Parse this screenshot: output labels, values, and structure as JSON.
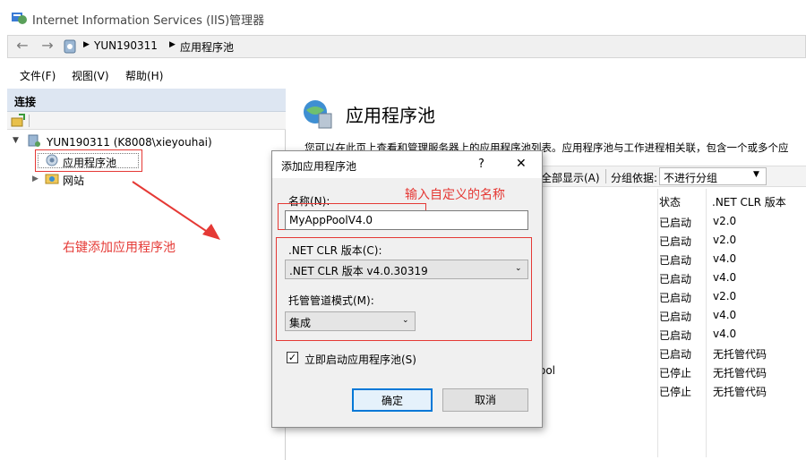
{
  "window": {
    "title": "Internet Information Services (IIS)管理器"
  },
  "address": {
    "crumbs": [
      "YUN190311",
      "应用程序池"
    ]
  },
  "menu": {
    "file": "文件(F)",
    "view": "视图(V)",
    "help": "帮助(H)"
  },
  "connections": {
    "header": "连接",
    "server_node": "YUN190311 (K8008\\xieyouhai)",
    "app_pools_node": "应用程序池",
    "sites_node": "网站"
  },
  "main": {
    "title": "应用程序池",
    "description": "您可以在此页上查看和管理服务器上的应用程序池列表。应用程序池与工作进程相关联，包含一个或多个应",
    "show_all": "全部显示(A)",
    "group_by_label": "分组依据:",
    "group_by_value": "不进行分组",
    "columns": {
      "status": "状态",
      "clr": ".NET CLR 版本"
    },
    "rows": [
      {
        "status": "已启动",
        "clr": "v2.0"
      },
      {
        "status": "已启动",
        "clr": "v2.0"
      },
      {
        "status": "已启动",
        "clr": "v4.0"
      },
      {
        "status": "已启动",
        "clr": "v4.0"
      },
      {
        "status": "已启动",
        "clr": "v2.0"
      },
      {
        "status": "已启动",
        "clr": "v4.0"
      },
      {
        "status": "已启动",
        "clr": "v4.0"
      },
      {
        "status": "已启动",
        "clr": "无托管代码"
      },
      {
        "status": "已停止",
        "clr": "无托管代码"
      },
      {
        "status": "已停止",
        "clr": "无托管代码"
      }
    ],
    "partial_row_name": "ool"
  },
  "dialog": {
    "title": "添加应用程序池",
    "help": "?",
    "close": "✕",
    "name_label": "名称(N):",
    "name_value": "MyAppPoolV4.0",
    "clr_label": ".NET CLR 版本(C):",
    "clr_value": ".NET CLR 版本 v4.0.30319",
    "pipeline_label": "托管管道模式(M):",
    "pipeline_value": "集成",
    "start_checkbox_label": "立即启动应用程序池(S)",
    "start_checked": true,
    "ok": "确定",
    "cancel": "取消"
  },
  "annotations": {
    "right_click_note": "右键添加应用程序池",
    "name_note": "输入自定义的名称",
    "color": "#e53935"
  }
}
